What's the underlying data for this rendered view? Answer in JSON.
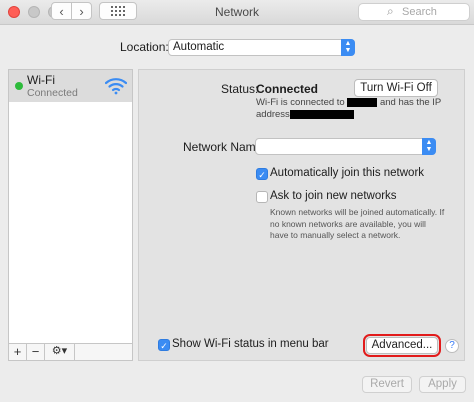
{
  "window": {
    "title": "Network",
    "search_placeholder": "Search"
  },
  "location": {
    "label": "Location:",
    "value": "Automatic"
  },
  "sidebar": {
    "items": [
      {
        "name": "Wi-Fi",
        "status": "Connected",
        "status_color": "#2dbb3b"
      }
    ],
    "tools": {
      "add": "+",
      "remove": "−",
      "gear": "⚙▾"
    }
  },
  "status": {
    "label": "Status:",
    "value": "Connected",
    "turn_off_label": "Turn Wi-Fi Off",
    "desc_part1": "Wi-Fi is connected to",
    "desc_part2": "and has the IP",
    "desc_part3": "address"
  },
  "network_name": {
    "label": "Network Name:",
    "value": ""
  },
  "options": {
    "auto_join_label": "Automatically join this network",
    "auto_join_checked": true,
    "ask_join_label": "Ask to join new networks",
    "ask_join_checked": false,
    "help_text": "Known networks will be joined automatically. If no known networks are available, you will have to manually select a network."
  },
  "footer": {
    "show_wifi_label": "Show Wi-Fi status in menu bar",
    "show_wifi_checked": true,
    "advanced_label": "Advanced...",
    "help_label": "?",
    "revert_label": "Revert",
    "apply_label": "Apply"
  },
  "colors": {
    "accent": "#3b8cf3",
    "highlight_box": "#e21b1b"
  }
}
